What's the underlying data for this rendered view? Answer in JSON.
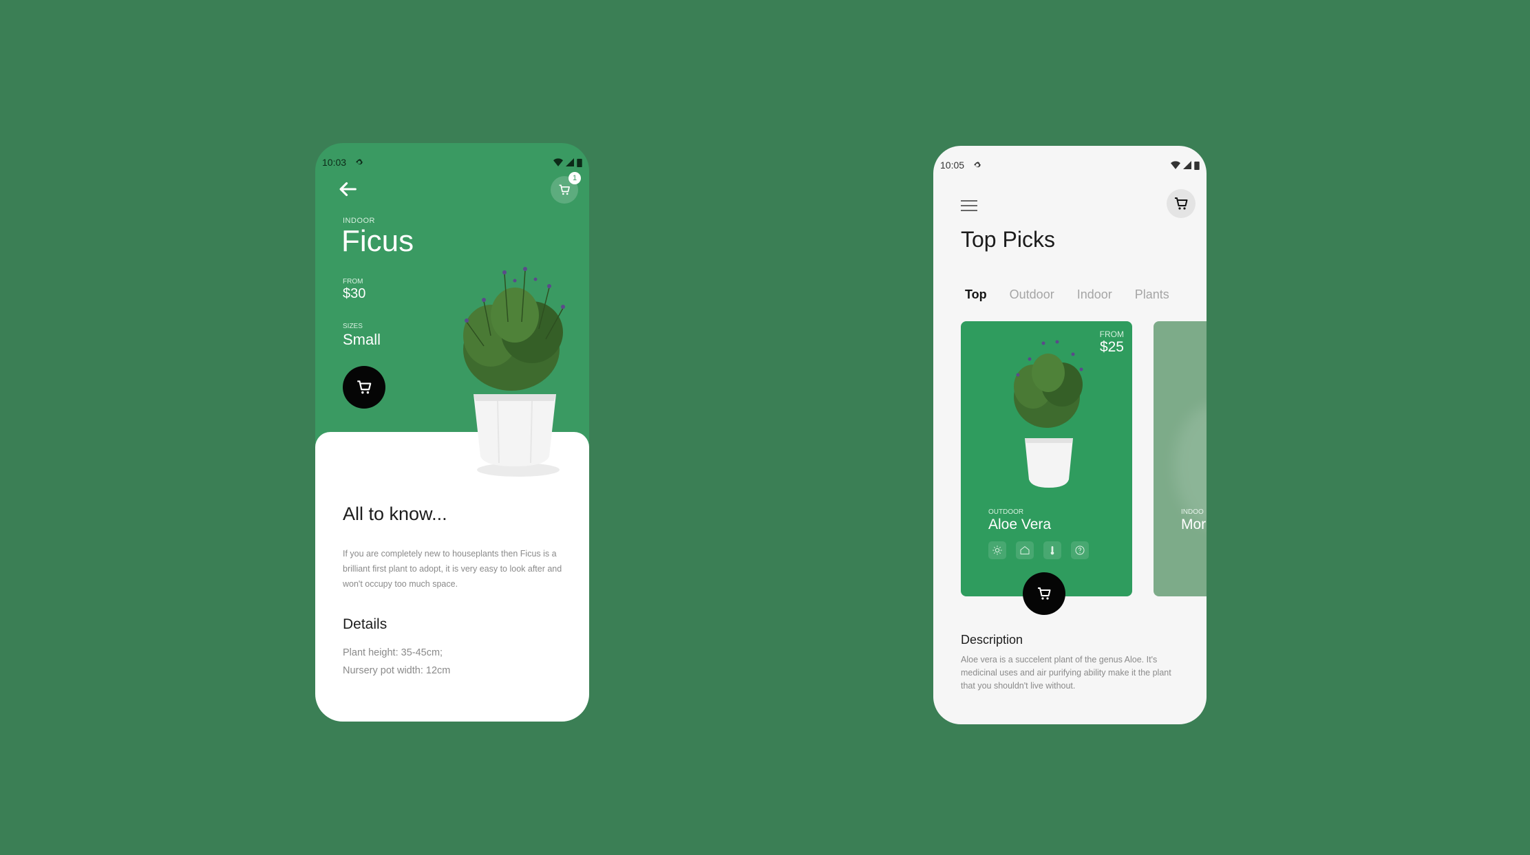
{
  "phone1": {
    "status": {
      "time": "10:03"
    },
    "cart_badge": "1",
    "category": "INDOOR",
    "title": "Ficus",
    "from_label": "FROM",
    "from_value": "$30",
    "sizes_label": "SIZES",
    "sizes_value": "Small",
    "info_heading": "All to know...",
    "info_text": "If you are completely new to houseplants then Ficus is a brilliant first plant to adopt, it is very easy to look after and won't occupy too much space.",
    "details_heading": "Details",
    "details": [
      "Plant height: 35-45cm;",
      "Nursery pot width: 12cm"
    ]
  },
  "phone2": {
    "status": {
      "time": "10:05"
    },
    "title": "Top Picks",
    "tabs": [
      {
        "label": "Top",
        "active": true
      },
      {
        "label": "Outdoor",
        "active": false
      },
      {
        "label": "Indoor",
        "active": false
      },
      {
        "label": "Plants",
        "active": false
      }
    ],
    "card": {
      "from_label": "FROM",
      "from_value": "$25",
      "category": "OUTDOOR",
      "name": "Aloe Vera",
      "icons": [
        "sun-icon",
        "home-icon",
        "thermometer-icon",
        "help-icon"
      ]
    },
    "card_peek": {
      "category": "INDOO",
      "name": "Mor"
    },
    "description_heading": "Description",
    "description_text": "Aloe vera is a succelent plant of the genus Aloe. It's medicinal uses and air purifying ability make it the plant that you shouldn't live without."
  },
  "colors": {
    "background": "#3b7f55",
    "primary_green": "#3a9a62",
    "card_green": "#2f9c5e",
    "dark": "#050505"
  }
}
